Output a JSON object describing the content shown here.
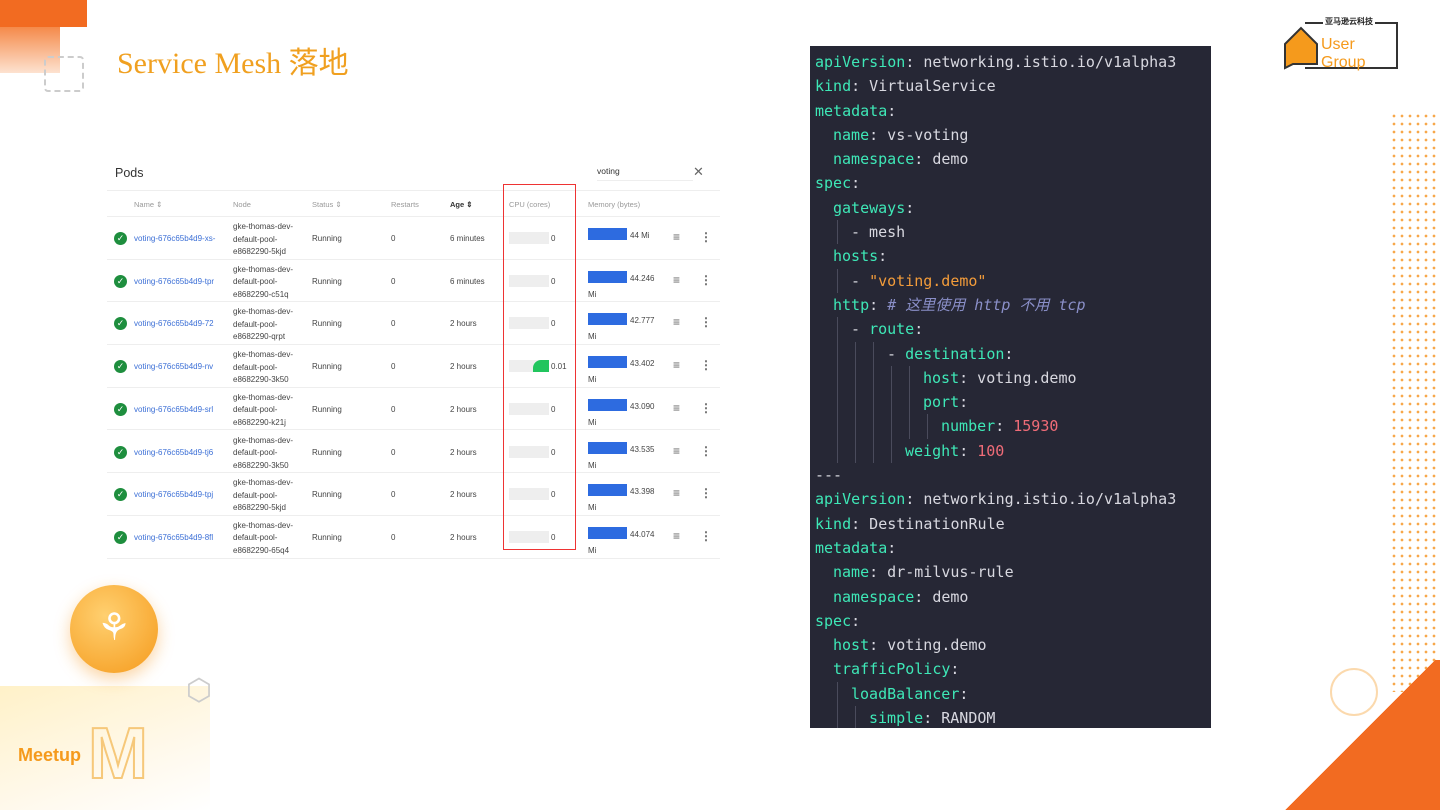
{
  "slide": {
    "title": "Service Mesh 落地",
    "logo_cn": "亚马逊云科技",
    "logo_en": "User Group",
    "meetup": "Meetup",
    "meetup_mark": "M"
  },
  "pods": {
    "title": "Pods",
    "search_value": "voting",
    "clear_icon": "✕",
    "headers": {
      "name": "Name ⇕",
      "node": "Node",
      "status": "Status ⇕",
      "restarts": "Restarts",
      "age": "Age ⇕",
      "cpu": "CPU (cores)",
      "memory": "Memory (bytes)"
    },
    "rows": [
      {
        "name": "voting-676c65b4d9-xs-",
        "node": "gke-thomas-dev-default-pool-e8682290-5kjd",
        "status": "Running",
        "restarts": "0",
        "age": "6 minutes",
        "cpu": "0",
        "cpu_fraction": 0,
        "memory": "44 Mi"
      },
      {
        "name": "voting-676c65b4d9-tpr",
        "node": "gke-thomas-dev-default-pool-e8682290-c51q",
        "status": "Running",
        "restarts": "0",
        "age": "6 minutes",
        "cpu": "0",
        "cpu_fraction": 0,
        "memory": "44.246 Mi"
      },
      {
        "name": "voting-676c65b4d9-72",
        "node": "gke-thomas-dev-default-pool-e8682290-qrpt",
        "status": "Running",
        "restarts": "0",
        "age": "2 hours",
        "cpu": "0",
        "cpu_fraction": 0,
        "memory": "42.777 Mi"
      },
      {
        "name": "voting-676c65b4d9-nv",
        "node": "gke-thomas-dev-default-pool-e8682290-3k50",
        "status": "Running",
        "restarts": "0",
        "age": "2 hours",
        "cpu": "0.01",
        "cpu_fraction": 0.4,
        "memory": "43.402 Mi"
      },
      {
        "name": "voting-676c65b4d9-srl",
        "node": "gke-thomas-dev-default-pool-e8682290-k21j",
        "status": "Running",
        "restarts": "0",
        "age": "2 hours",
        "cpu": "0",
        "cpu_fraction": 0,
        "memory": "43.090 Mi"
      },
      {
        "name": "voting-676c65b4d9-tj6",
        "node": "gke-thomas-dev-default-pool-e8682290-3k50",
        "status": "Running",
        "restarts": "0",
        "age": "2 hours",
        "cpu": "0",
        "cpu_fraction": 0,
        "memory": "43.535 Mi"
      },
      {
        "name": "voting-676c65b4d9-tpj",
        "node": "gke-thomas-dev-default-pool-e8682290-5kjd",
        "status": "Running",
        "restarts": "0",
        "age": "2 hours",
        "cpu": "0",
        "cpu_fraction": 0,
        "memory": "43.398 Mi"
      },
      {
        "name": "voting-676c65b4d9-8fl",
        "node": "gke-thomas-dev-default-pool-e8682290-65q4",
        "status": "Running",
        "restarts": "0",
        "age": "2 hours",
        "cpu": "0",
        "cpu_fraction": 0,
        "memory": "44.074 Mi"
      }
    ]
  },
  "code": {
    "lines": [
      [
        0,
        [
          [
            "apiVersion",
            "k"
          ],
          [
            ": networking.istio.io/v1alpha3",
            "p"
          ]
        ]
      ],
      [
        0,
        [
          [
            "kind",
            "k"
          ],
          [
            ": VirtualService",
            "p"
          ]
        ]
      ],
      [
        0,
        [
          [
            "metadata",
            "k"
          ],
          [
            ":",
            "p"
          ]
        ]
      ],
      [
        1,
        [
          [
            "name",
            "k"
          ],
          [
            ": vs-voting",
            "p"
          ]
        ]
      ],
      [
        1,
        [
          [
            "namespace",
            "k"
          ],
          [
            ": demo",
            "p"
          ]
        ]
      ],
      [
        0,
        [
          [
            "spec",
            "k"
          ],
          [
            ":",
            "p"
          ]
        ]
      ],
      [
        1,
        [
          [
            "gateways",
            "k"
          ],
          [
            ":",
            "p"
          ]
        ]
      ],
      [
        2,
        [
          [
            "- mesh",
            "p"
          ]
        ]
      ],
      [
        1,
        [
          [
            "hosts",
            "k"
          ],
          [
            ":",
            "p"
          ]
        ]
      ],
      [
        2,
        [
          [
            "- ",
            "p"
          ],
          [
            "\"voting.demo\"",
            "s"
          ]
        ]
      ],
      [
        1,
        [
          [
            "http",
            "k"
          ],
          [
            ": ",
            "p"
          ],
          [
            "# 这里使用 http 不用 tcp",
            "c"
          ]
        ]
      ],
      [
        2,
        [
          [
            "- ",
            "p"
          ],
          [
            "route",
            "k"
          ],
          [
            ":",
            "p"
          ]
        ]
      ],
      [
        4,
        [
          [
            "- ",
            "p"
          ],
          [
            "destination",
            "k"
          ],
          [
            ":",
            "p"
          ]
        ]
      ],
      [
        6,
        [
          [
            "host",
            "k"
          ],
          [
            ": voting.demo",
            "p"
          ]
        ]
      ],
      [
        6,
        [
          [
            "port",
            "k"
          ],
          [
            ":",
            "p"
          ]
        ]
      ],
      [
        7,
        [
          [
            "number",
            "k"
          ],
          [
            ": ",
            "p"
          ],
          [
            "15930",
            "n"
          ]
        ]
      ],
      [
        5,
        [
          [
            "weight",
            "k"
          ],
          [
            ": ",
            "p"
          ],
          [
            "100",
            "n"
          ]
        ]
      ],
      [
        0,
        [
          [
            "---",
            "p"
          ]
        ]
      ],
      [
        0,
        [
          [
            "apiVersion",
            "k"
          ],
          [
            ": networking.istio.io/v1alpha3",
            "p"
          ]
        ]
      ],
      [
        0,
        [
          [
            "kind",
            "k"
          ],
          [
            ": DestinationRule",
            "p"
          ]
        ]
      ],
      [
        0,
        [
          [
            "metadata",
            "k"
          ],
          [
            ":",
            "p"
          ]
        ]
      ],
      [
        1,
        [
          [
            "name",
            "k"
          ],
          [
            ": dr-milvus-rule",
            "p"
          ]
        ]
      ],
      [
        1,
        [
          [
            "namespace",
            "k"
          ],
          [
            ": demo",
            "p"
          ]
        ]
      ],
      [
        0,
        [
          [
            "spec",
            "k"
          ],
          [
            ":",
            "p"
          ]
        ]
      ],
      [
        1,
        [
          [
            "host",
            "k"
          ],
          [
            ": voting.demo",
            "p"
          ]
        ]
      ],
      [
        1,
        [
          [
            "trafficPolicy",
            "k"
          ],
          [
            ":",
            "p"
          ]
        ]
      ],
      [
        2,
        [
          [
            "loadBalancer",
            "k"
          ],
          [
            ":",
            "p"
          ]
        ]
      ],
      [
        3,
        [
          [
            "simple",
            "k"
          ],
          [
            ": RANDOM",
            "p"
          ]
        ]
      ]
    ]
  }
}
